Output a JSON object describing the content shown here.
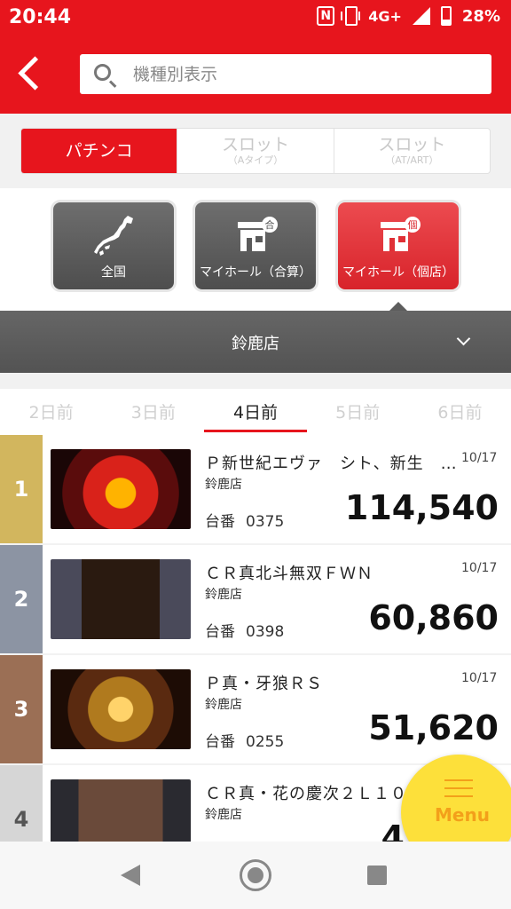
{
  "status_bar": {
    "time": "20:44",
    "nfc": "N",
    "network": "4G+",
    "battery": "28%"
  },
  "header": {
    "search_placeholder": "機種別表示"
  },
  "type_tabs": [
    {
      "main": "パチンコ",
      "sub": "",
      "active": true
    },
    {
      "main": "スロット",
      "sub": "（Aタイプ）",
      "active": false
    },
    {
      "main": "スロット",
      "sub": "（AT/ART）",
      "active": false
    }
  ],
  "categories": [
    {
      "label": "全国",
      "icon": "japan-map-icon",
      "active": false
    },
    {
      "label": "マイホール（合算）",
      "icon": "hall-combined-icon",
      "badge": "合",
      "active": false
    },
    {
      "label": "マイホール（個店）",
      "icon": "hall-individual-icon",
      "badge": "個",
      "active": true
    }
  ],
  "store_select": {
    "name": "鈴鹿店"
  },
  "day_tabs": [
    "2日前",
    "3日前",
    "4日前",
    "5日前",
    "6日前"
  ],
  "active_day": "4日前",
  "rows": [
    {
      "rank": "1",
      "rank_color": "#d2b65e",
      "title": "Ｐ新世紀エヴァ　シト、新生　…",
      "date": "10/17",
      "store": "鈴鹿店",
      "machine_label": "台番",
      "machine_no": "0375",
      "value": "114,540"
    },
    {
      "rank": "2",
      "rank_color": "#8c94a3",
      "title": "ＣＲ真北斗無双ＦＷＮ",
      "date": "10/17",
      "store": "鈴鹿店",
      "machine_label": "台番",
      "machine_no": "0398",
      "value": "60,860"
    },
    {
      "rank": "3",
      "rank_color": "#9b6f55",
      "title": "Ｐ真・牙狼ＲＳ",
      "date": "10/17",
      "store": "鈴鹿店",
      "machine_label": "台番",
      "machine_no": "0255",
      "value": "51,620"
    },
    {
      "rank": "4",
      "rank_color": "#d6d6d6",
      "title": "ＣＲ真・花の慶次２Ｌ１０",
      "date": "",
      "store": "鈴鹿店",
      "machine_label": "",
      "machine_no": "",
      "value": "4"
    }
  ],
  "fab": {
    "label": "Menu"
  },
  "colors": {
    "brand": "#e7151d",
    "fab": "#fde03a",
    "fab_text": "#f3a01a"
  }
}
